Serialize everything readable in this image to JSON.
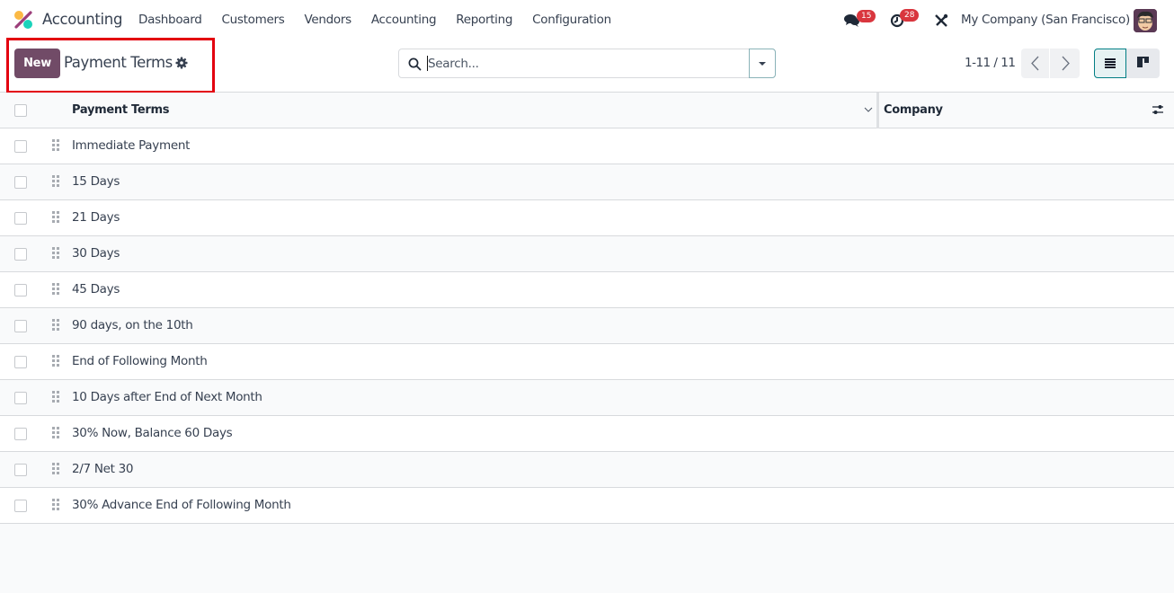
{
  "navbar": {
    "app_name": "Accounting",
    "menu": [
      "Dashboard",
      "Customers",
      "Vendors",
      "Accounting",
      "Reporting",
      "Configuration"
    ],
    "messages_count": "15",
    "activities_count": "28",
    "company": "My Company (San Francisco)"
  },
  "control_panel": {
    "new_label": "New",
    "title": "Payment Terms",
    "search_placeholder": "Search...",
    "pager": "1-11 / 11"
  },
  "table": {
    "columns": [
      "Payment Terms",
      "Company"
    ],
    "rows": [
      {
        "name": "Immediate Payment",
        "company": ""
      },
      {
        "name": "15 Days",
        "company": ""
      },
      {
        "name": "21 Days",
        "company": ""
      },
      {
        "name": "30 Days",
        "company": ""
      },
      {
        "name": "45 Days",
        "company": ""
      },
      {
        "name": "90 days, on the 10th",
        "company": ""
      },
      {
        "name": "End of Following Month",
        "company": ""
      },
      {
        "name": "10 Days after End of Next Month",
        "company": ""
      },
      {
        "name": "30% Now, Balance 60 Days",
        "company": ""
      },
      {
        "name": "2/7 Net 30",
        "company": ""
      },
      {
        "name": "30% Advance End of Following Month",
        "company": ""
      }
    ]
  },
  "colors": {
    "brand": "#714b67",
    "accent": "#017e84",
    "badge": "#d9363e",
    "highlight": "#e3000f"
  }
}
